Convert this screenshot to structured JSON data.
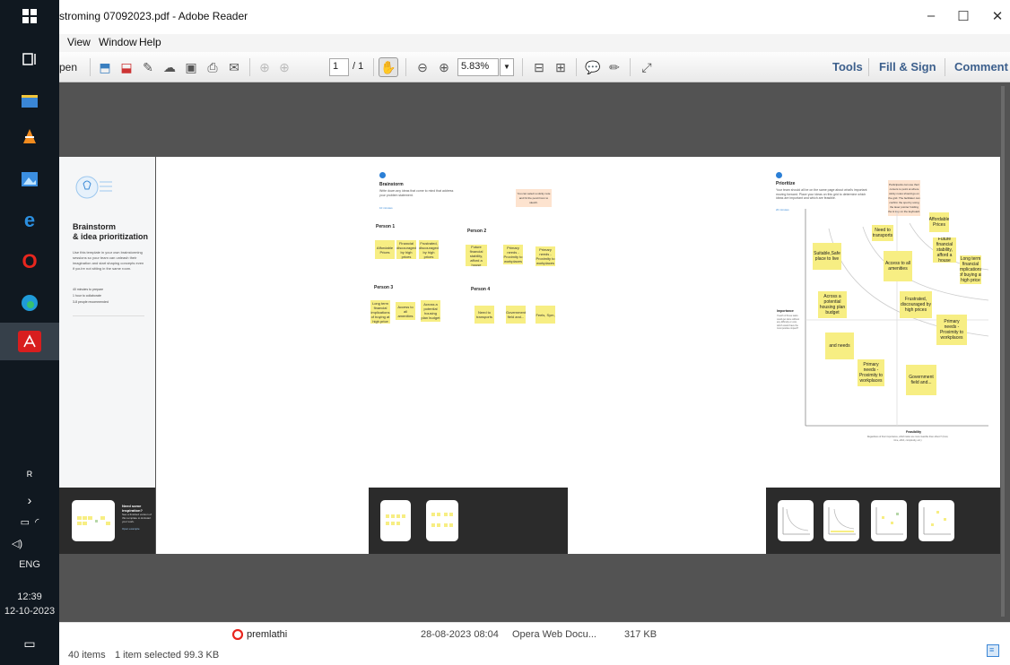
{
  "window": {
    "title": "stroming 07092023.pdf - Adobe Reader",
    "minimize": "–",
    "maximize": "☐",
    "close": "✕"
  },
  "menu": [
    "View",
    "Window",
    "Help"
  ],
  "toolbar": {
    "open_label": "pen",
    "page_current": "1",
    "page_total": "/ 1",
    "zoom": "5.83%",
    "tools": "Tools",
    "fill_sign": "Fill & Sign",
    "comment": "Comment"
  },
  "taskbar": {
    "language": "ENG",
    "time": "12:39",
    "date": "12-10-2023"
  },
  "page1": {
    "heading_line1": "Brainstorm",
    "heading_line2": "& idea prioritization",
    "body": "Use this template in your own brainstorming sessions so your team can unleash their imagination and start shaping concepts even if you're not sitting in the same room.",
    "bullet1": "40 minutes to prepare",
    "bullet2": "1 hour to collaborate",
    "bullet3": "3-8 people recommended",
    "footer_title": "Need some inspiration?",
    "footer_text": "See a finished version of this template to kickstart your work.",
    "footer_button": "Open example"
  },
  "page2": {
    "step": "Brainstorm",
    "subtitle": "Write down any ideas that come to mind that address your problem statement.",
    "timer": "10 minutes",
    "tip": "You can select a sticky note and hit the pencil icon to sketch.",
    "person1": "Person 1",
    "person2": "Person 2",
    "person3": "Person 3",
    "person4": "Person 4",
    "p1_notes": [
      "Affordable Prices",
      "Financial discouraged by high prices",
      "Frustrated, discouraged by high prices"
    ],
    "p2_notes": [
      "Future financial stability, afford a house",
      "Primary needs - Proximity to workplaces",
      "Primary needs - Proximity to workplaces"
    ],
    "p3_notes": [
      "Long term financial implications of buying at high price",
      "Access to all amenities",
      "Across a potential housing plan budget"
    ],
    "p4_notes": [
      "Need to transports",
      "Government field and...",
      "Feels, Sym,"
    ]
  },
  "page3": {
    "step": "Prioritize",
    "subtitle": "Your team should all be on the same page about what's important moving forward. Place your ideas on this grid to determine which ideas are important and which are feasible.",
    "timer": "20 minutes",
    "tip": "Participants can use their cursors to point at where sticky notes should go on the grid. The facilitator can confirm the spot by using the laser pointer holding the H key on the keyboard.",
    "y_label": "Importance",
    "y_desc": "If each of these tasks could get done without any difficulty or cost, which would have the most positive impact?",
    "x_label": "Feasibility",
    "x_desc": "Regardless of their importance, which tasks are more feasible than others? (Cost, time, effort, complexity, etc.)",
    "notes": [
      "Affordable Prices",
      "Need to transports",
      "Future financial stability, afford a house",
      "Long term financial implications of buying at high price",
      "Suitable,Safe place to live",
      "Access to all amenities",
      "Across a potential housing plan budget",
      "Frustrated, discouraged by high prices",
      "Primary needs - Proximity to workplaces",
      "and needs",
      "Primary needs - Proximity to workplaces",
      "Government field and..."
    ]
  },
  "explorer": {
    "items": "40 items",
    "selected": "1 item selected  99.3 KB",
    "file_name": "premlathi",
    "file_date": "28-08-2023 08:04",
    "file_type": "Opera Web Docu...",
    "file_size": "317 KB"
  },
  "colors": {
    "sticky": "#f7ee83",
    "tool_link": "#3c5f8c",
    "doc_bg": "#535353"
  }
}
